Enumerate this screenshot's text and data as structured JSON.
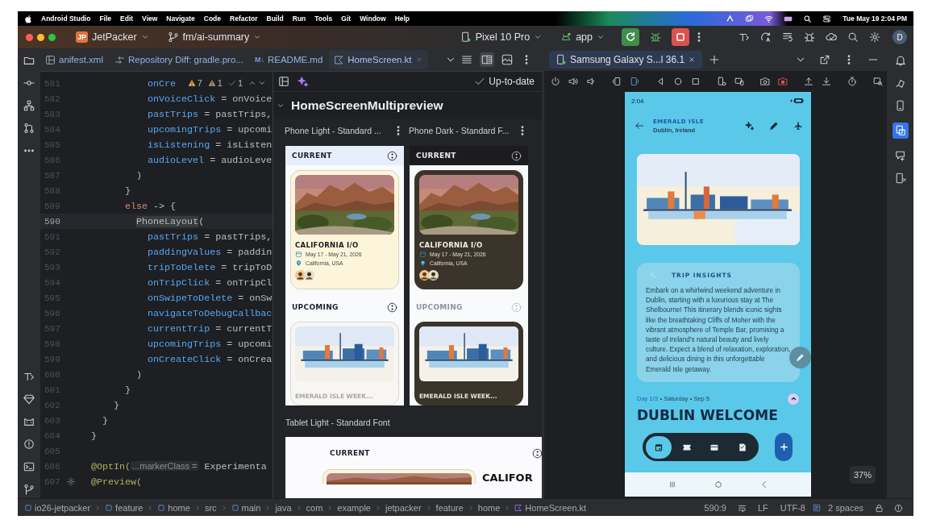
{
  "menubar": {
    "app": "Android Studio",
    "menus": [
      "File",
      "Edit",
      "View",
      "Navigate",
      "Code",
      "Refactor",
      "Build",
      "Run",
      "Tools",
      "Git",
      "Window",
      "Help"
    ],
    "clock": "Tue May 19  2:04 PM"
  },
  "toolbar": {
    "project_badge": "JP",
    "project": "JetPacker",
    "branch": "fm/ai-summary",
    "device": "Pixel 10 Pro",
    "run_config": "app",
    "avatar": "D"
  },
  "editor_tabs": [
    {
      "label": "anifest.xml",
      "kind": "xml",
      "selected": false
    },
    {
      "label": "Repository Diff: gradle.pro...",
      "kind": "diff",
      "selected": false
    },
    {
      "label": "README.md",
      "kind": "markdown",
      "badge": "M↓",
      "selected": false
    },
    {
      "label": "HomeScreen.kt",
      "kind": "kotlin",
      "selected": true
    }
  ],
  "inspections": {
    "warnings": "7",
    "weak_warnings": "1",
    "typos": "1"
  },
  "code_lines": [
    {
      "number": "581",
      "current": false,
      "parts": [
        {
          "kind": "param",
          "text": "          onCre"
        }
      ]
    },
    {
      "number": "582",
      "current": false,
      "parts": [
        {
          "kind": "param",
          "text": "          onVoiceClick"
        },
        {
          "kind": "plain",
          "text": " = onVoice"
        }
      ]
    },
    {
      "number": "583",
      "current": false,
      "parts": [
        {
          "kind": "param",
          "text": "          pastTrips"
        },
        {
          "kind": "plain",
          "text": " = pastTrips,"
        }
      ]
    },
    {
      "number": "584",
      "current": false,
      "parts": [
        {
          "kind": "param",
          "text": "          upcomingTrips"
        },
        {
          "kind": "plain",
          "text": " = upcomi"
        }
      ]
    },
    {
      "number": "585",
      "current": false,
      "parts": [
        {
          "kind": "param",
          "text": "          isListening"
        },
        {
          "kind": "plain",
          "text": " = isListen"
        }
      ]
    },
    {
      "number": "586",
      "current": false,
      "parts": [
        {
          "kind": "param",
          "text": "          audioLevel"
        },
        {
          "kind": "plain",
          "text": " = audioLeve"
        }
      ]
    },
    {
      "number": "587",
      "current": false,
      "parts": [
        {
          "kind": "plain",
          "text": "        )"
        }
      ]
    },
    {
      "number": "588",
      "current": false,
      "parts": [
        {
          "kind": "plain",
          "text": "      }"
        }
      ]
    },
    {
      "number": "589",
      "current": false,
      "parts": [
        {
          "kind": "keyword",
          "text": "      else"
        },
        {
          "kind": "plain",
          "text": " -> {"
        }
      ]
    },
    {
      "number": "590",
      "current": true,
      "parts": [
        {
          "kind": "usage",
          "text": "        PhoneLayout"
        },
        {
          "kind": "plain",
          "text": "("
        }
      ]
    },
    {
      "number": "591",
      "current": false,
      "parts": [
        {
          "kind": "param",
          "text": "          pastTrips"
        },
        {
          "kind": "plain",
          "text": " = pastTrips,"
        }
      ]
    },
    {
      "number": "592",
      "current": false,
      "parts": [
        {
          "kind": "param",
          "text": "          paddingValues"
        },
        {
          "kind": "plain",
          "text": " = paddin"
        }
      ]
    },
    {
      "number": "593",
      "current": false,
      "parts": [
        {
          "kind": "param",
          "text": "          tripToDelete"
        },
        {
          "kind": "plain",
          "text": " = tripToD"
        }
      ]
    },
    {
      "number": "594",
      "current": false,
      "parts": [
        {
          "kind": "param",
          "text": "          onTripClick"
        },
        {
          "kind": "plain",
          "text": " = onTripCl"
        }
      ]
    },
    {
      "number": "595",
      "current": false,
      "parts": [
        {
          "kind": "param",
          "text": "          onSwipeToDelete"
        },
        {
          "kind": "plain",
          "text": " = onSw"
        }
      ]
    },
    {
      "number": "596",
      "current": false,
      "parts": [
        {
          "kind": "param",
          "text": "          navigateToDebugCallbac"
        }
      ]
    },
    {
      "number": "597",
      "current": false,
      "parts": [
        {
          "kind": "param",
          "text": "          currentTrip"
        },
        {
          "kind": "plain",
          "text": " = currentT"
        }
      ]
    },
    {
      "number": "598",
      "current": false,
      "parts": [
        {
          "kind": "param",
          "text": "          upcomingTrips"
        },
        {
          "kind": "plain",
          "text": " = upcomi"
        }
      ]
    },
    {
      "number": "599",
      "current": false,
      "parts": [
        {
          "kind": "param",
          "text": "          onCreateClick"
        },
        {
          "kind": "plain",
          "text": " = onCrea"
        }
      ]
    },
    {
      "number": "600",
      "current": false,
      "parts": [
        {
          "kind": "plain",
          "text": "        )"
        }
      ]
    },
    {
      "number": "601",
      "current": false,
      "parts": [
        {
          "kind": "plain",
          "text": "      }"
        }
      ]
    },
    {
      "number": "602",
      "current": false,
      "parts": [
        {
          "kind": "plain",
          "text": "    }"
        }
      ]
    },
    {
      "number": "603",
      "current": false,
      "parts": [
        {
          "kind": "plain",
          "text": "  }"
        }
      ]
    },
    {
      "number": "604",
      "current": false,
      "parts": [
        {
          "kind": "plain",
          "text": "}"
        }
      ]
    },
    {
      "number": "605",
      "current": false
    },
    {
      "number": "606",
      "current": false,
      "parts": [
        {
          "kind": "annotation",
          "text": "@OptIn("
        },
        {
          "kind": "inlay",
          "text": "...markerClass ="
        },
        {
          "kind": "plain",
          "text": " Experimenta"
        }
      ]
    },
    {
      "number": "607",
      "current": false,
      "kind": "preview_entry",
      "parts": [
        {
          "kind": "annotation",
          "text": "@Preview("
        }
      ]
    }
  ],
  "preview": {
    "status": "Up-to-date",
    "group": "HomeScreenMultipreview",
    "expanded": true,
    "phones": [
      {
        "label": "Phone Light - Standard ...",
        "kind": "light",
        "current_header": "CURRENT",
        "trip": "CALIFORNIA I/O",
        "dates": "May 17 - May 21, 2026",
        "place": "California, USA",
        "upcoming_header": "UPCOMING",
        "upcoming_trip": "EMERALD ISLE WEEK..."
      },
      {
        "label": "Phone Dark - Standard F...",
        "kind": "dark",
        "current_header": "CURRENT",
        "trip": "CALIFORNIA I/O",
        "dates": "May 17 - May 21, 2026",
        "place": "California, USA",
        "upcoming_header": "UPCOMING",
        "upcoming_trip": "EMERALD ISLE WEEK..."
      }
    ],
    "tablet": {
      "label": "Tablet Light - Standard Font",
      "header": "CURRENT",
      "trip": "CALIFOR"
    }
  },
  "emulator": {
    "tab": "Samsung Galaxy S...l 36.1",
    "zoom": "37%",
    "phone": {
      "time": "2:04",
      "title": "EMERALD ISLE",
      "subtitle": "Dublin, Ireland",
      "insights_title": "TRIP INSIGHTS",
      "insights": "Embark on a whirlwind weekend adventure in Dublin, starting with a luxurious stay at The Shelbourne! This itinerary blends iconic sights like the breathtaking Cliffs of Moher with the vibrant atmosphere of Temple Bar, promising a taste of Ireland's natural beauty and lively culture. Expect a blend of relaxation, exploration, and delicious dining in this unforgettable Emerald Isle getaway.",
      "day": "Day 1/3",
      "day_detail": "• Saturday • Sep 5",
      "heading": "DUBLIN WELCOME",
      "nav": [
        {
          "kind": "calendar",
          "selected": true
        },
        {
          "kind": "ticket",
          "selected": false
        },
        {
          "kind": "wallet",
          "selected": false
        },
        {
          "kind": "checklist",
          "selected": false
        }
      ]
    }
  },
  "status_bar": {
    "breadcrumbs": [
      {
        "label": "io26-jetpacker",
        "kind": "module"
      },
      {
        "label": "feature",
        "kind": "module"
      },
      {
        "label": "home",
        "kind": "module"
      },
      {
        "label": "src",
        "kind": "plain"
      },
      {
        "label": "main",
        "kind": "module"
      },
      {
        "label": "java",
        "kind": "plain"
      },
      {
        "label": "com",
        "kind": "plain"
      },
      {
        "label": "example",
        "kind": "plain"
      },
      {
        "label": "jetpacker",
        "kind": "plain"
      },
      {
        "label": "feature",
        "kind": "plain"
      },
      {
        "label": "home",
        "kind": "plain"
      },
      {
        "label": "HomeScreen.kt",
        "kind": "kotlin"
      }
    ],
    "position": "590:9",
    "line_ending": "LF",
    "encoding": "UTF-8",
    "indent": "2 spaces"
  }
}
